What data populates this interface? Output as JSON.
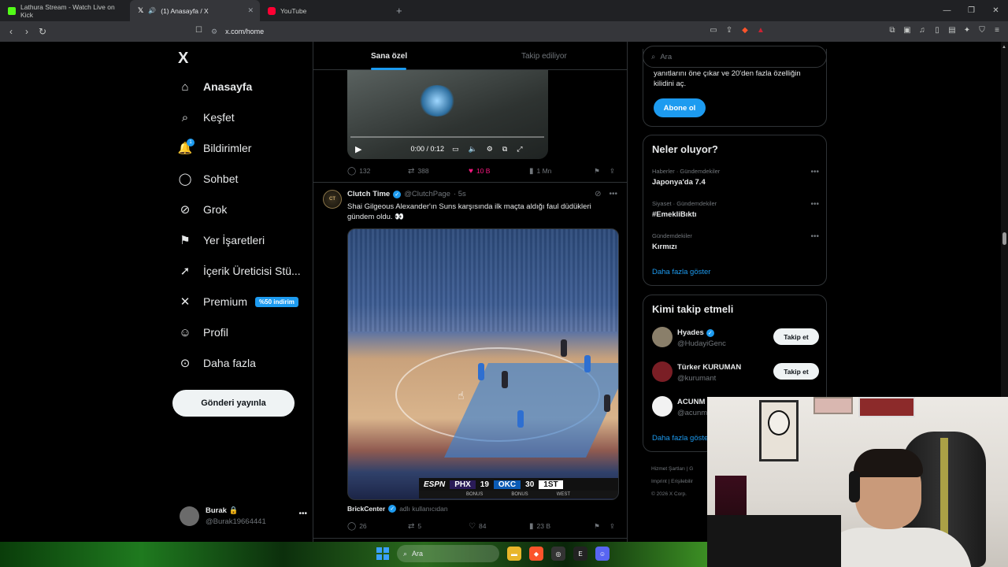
{
  "browser": {
    "tabs": [
      {
        "title": "Lathura Stream - Watch Live on Kick",
        "favicon_color": "#53fc18",
        "active": false
      },
      {
        "title": "(1) Anasayfa / X",
        "favicon_color": "#ffffff",
        "active": true
      },
      {
        "title": "YouTube",
        "favicon_color": "#ff0033",
        "active": false
      }
    ],
    "url": "x.com/home"
  },
  "sidebar": {
    "logo": "X",
    "items": [
      {
        "label": "Anasayfa",
        "icon": "home-icon"
      },
      {
        "label": "Keşfet",
        "icon": "search-icon"
      },
      {
        "label": "Bildirimler",
        "icon": "bell-icon",
        "badge": "1"
      },
      {
        "label": "Sohbet",
        "icon": "chat-icon"
      },
      {
        "label": "Grok",
        "icon": "grok-icon"
      },
      {
        "label": "Yer İşaretleri",
        "icon": "bookmark-icon"
      },
      {
        "label": "İçerik Üreticisi Stü...",
        "icon": "rocket-icon"
      },
      {
        "label": "Premium",
        "icon": "x-icon",
        "badge_text": "%50 indirim"
      },
      {
        "label": "Profil",
        "icon": "person-icon"
      },
      {
        "label": "Daha fazla",
        "icon": "more-circle-icon"
      }
    ],
    "post_button": "Gönderi yayınla",
    "user": {
      "name": "Burak",
      "handle": "@Burak19664441"
    }
  },
  "timeline": {
    "tabs": [
      "Sana özel",
      "Takip ediliyor"
    ],
    "tweet1": {
      "video_time": "0:00 / 0:12",
      "actions": {
        "replies": "132",
        "reposts": "388",
        "likes": "10 B",
        "views": "1 Mn"
      }
    },
    "tweet2": {
      "avatar_text": "CT",
      "name": "Clutch Time",
      "handle": "@ClutchPage",
      "time": "· 5s",
      "text": "Shai Gilgeous Alexander'ın Suns karşısında ilk maçta aldığı faul düdükleri gündem oldu. 👀",
      "scoreboard": {
        "network": "ESPN",
        "team1": "PHX",
        "score1": "19",
        "team2": "OKC",
        "score2": "30",
        "period": "1ST",
        "bonus1": "BONUS",
        "bonus2": "BONUS",
        "conference": "WEST"
      },
      "attribution_name": "BrickCenter",
      "attribution_sub": "adlı kullanıcıdan",
      "actions": {
        "replies": "26",
        "reposts": "5",
        "likes": "84",
        "views": "23 B"
      }
    }
  },
  "right": {
    "search_placeholder": "Ara",
    "premium_text": "yanıtlarını öne çıkar ve 20'den fazla özelliğin kilidini aç.",
    "subscribe": "Abone ol",
    "trends_title": "Neler oluyor?",
    "trends": [
      {
        "context": "Haberler · Gündemdekiler",
        "topic": "Japonya'da 7.4"
      },
      {
        "context": "Siyaset · Gündemdekiler",
        "topic": "#EmekliBıktı"
      },
      {
        "context": "Gündemdekiler",
        "topic": "Kırmızı"
      }
    ],
    "show_more": "Daha fazla göster",
    "follow_title": "Kimi takip etmeli",
    "suggestions": [
      {
        "name": "Hyades",
        "handle": "@HudayiGenc",
        "verified": true,
        "button": "Takip et",
        "avatar_color": "#8a7f6a"
      },
      {
        "name": "Türker KURUMAN",
        "handle": "@kurumant",
        "verified": false,
        "button": "Takip et",
        "avatar_color": "#7a1e25"
      },
      {
        "name": "ACUNM",
        "handle": "@acunm",
        "verified": false,
        "button": "",
        "avatar_color": "#f2f2f2"
      }
    ],
    "follow_show_more": "Daha fazla göster",
    "footer": [
      "Hizmet Şartları  |  G",
      "Imprint  |  Erişilebilir",
      "© 2026 X Corp."
    ]
  },
  "taskbar": {
    "search": "Ara"
  }
}
